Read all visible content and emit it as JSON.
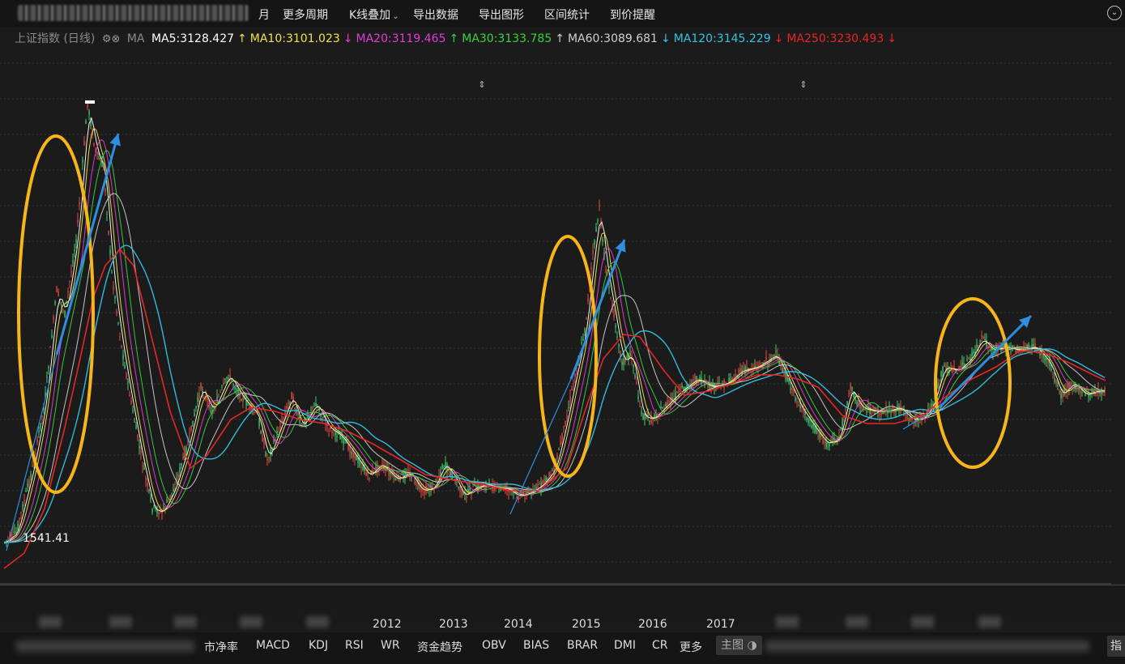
{
  "toolbar": {
    "items": [
      "月",
      "更多周期",
      "K线叠加",
      "导出数据",
      "导出图形",
      "区间统计",
      "到价提醒"
    ]
  },
  "ma_bar": {
    "index_name": "上证指数 (日线)",
    "label": "MA",
    "values": [
      {
        "text": "MA5:3128.427",
        "arrow": "",
        "color": "#ffffff"
      },
      {
        "text": "MA10:3101.023",
        "arrow": "↑",
        "color": "#f2e14a"
      },
      {
        "text": "MA20:3119.465",
        "arrow": "↓",
        "color": "#e23bd8"
      },
      {
        "text": "MA30:3133.785",
        "arrow": "↑",
        "color": "#39d23c"
      },
      {
        "text": "MA60:3089.681",
        "arrow": "↑",
        "color": "#cfcfcf"
      },
      {
        "text": "MA120:3145.229",
        "arrow": "↓",
        "color": "#33c3e6"
      },
      {
        "text": "MA250:3230.493",
        "arrow": "↓",
        "color": "#e52727"
      }
    ],
    "first_arrow": "↑"
  },
  "chart": {
    "low_label": "1541.41",
    "years": [
      "2012",
      "2013",
      "2014",
      "2015",
      "2016",
      "2017"
    ]
  },
  "indicators": [
    "市净率",
    "MACD",
    "KDJ",
    "RSI",
    "WR",
    "资金趋势",
    "OBV",
    "BIAS",
    "BRAR",
    "DMI",
    "CR",
    "更多"
  ],
  "main_chart_btn": "主图",
  "right_btn": "指",
  "colors": {
    "ma5": "#ffffff",
    "ma10": "#f2e14a",
    "ma20": "#e23bd8",
    "ma30": "#39d23c",
    "ma60": "#cfcfcf",
    "ma120": "#33c3e6",
    "ma250": "#e52727",
    "highlight_ellipse": "#f5b51b",
    "trend_arrow": "#2e8fe0"
  }
}
